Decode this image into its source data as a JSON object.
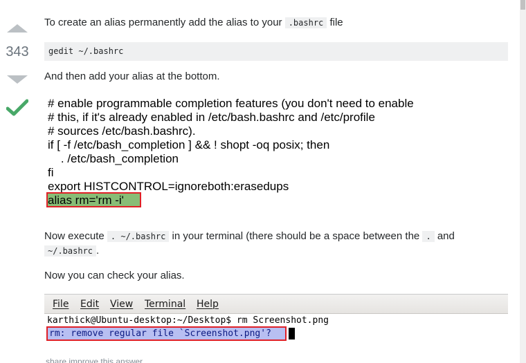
{
  "vote": {
    "count": "343"
  },
  "post": {
    "intro_before": "To create an alias permanently add the alias to your ",
    "intro_code": ".bashrc",
    "intro_after": " file",
    "command": "gedit ~/.bashrc",
    "add_text": "And then add your alias at the bottom.",
    "bashrc_lines": [
      "# enable programmable completion features (you don't need to enable",
      "# this, if it's already enabled in /etc/bash.bashrc and /etc/profile",
      "# sources /etc/bash.bashrc).",
      "if [ -f /etc/bash_completion ] && ! shopt -oq posix; then",
      "    . /etc/bash_completion",
      "fi",
      "export HISTCONTROL=ignoreboth:erasedups"
    ],
    "alias_line": "alias rm='rm -i'",
    "execute_before": "Now execute ",
    "execute_code": ". ~/.bashrc",
    "execute_middle": " in your terminal (there should be a space between the ",
    "execute_dot": ".",
    "execute_and": " and",
    "execute_code2": "~/.bashrc",
    "execute_end": ".",
    "check_text": "Now you can check your alias."
  },
  "terminal": {
    "menu": [
      "File",
      "Edit",
      "View",
      "Terminal",
      "Help"
    ],
    "prompt_line": "karthick@Ubuntu-desktop:~/Desktop$ rm Screenshot.png",
    "output_line": "rm: remove regular file `Screenshot.png'?"
  },
  "footer": {
    "share_text": "share  improve this answer"
  },
  "colors": {
    "accepted": "#48a868",
    "highlight_red": "#e01f26",
    "alias_bg": "#88bd76",
    "terminal_select": "#b8bff2"
  }
}
